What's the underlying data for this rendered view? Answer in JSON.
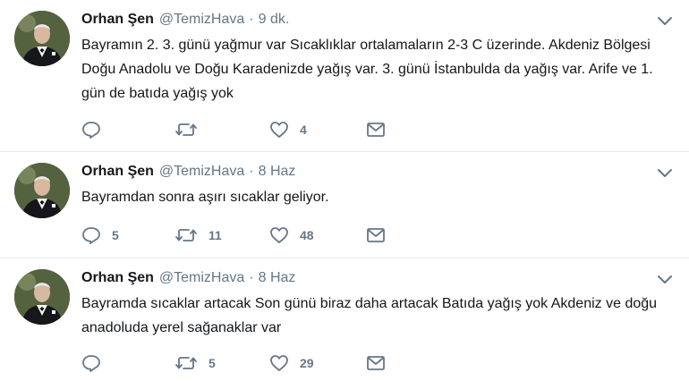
{
  "colors": {
    "text": "#14171a",
    "secondary": "#657786",
    "divider": "#e6ecf0",
    "background": "#ffffff"
  },
  "icons": {
    "caret": "chevron-down-icon",
    "reply": "reply-icon",
    "retweet": "retweet-icon",
    "like": "heart-icon",
    "message": "envelope-icon"
  },
  "tweets": [
    {
      "name": "Orhan Şen",
      "handle": "@TemizHava",
      "separator": "·",
      "time": "9 dk.",
      "text": "Bayramın 2. 3. günü yağmur var Sıcaklıklar ortalamaların 2-3 C üzerinde. Akdeniz Bölgesi Doğu Anadolu ve Doğu Karadenizde yağış var. 3. günü İstanbulda da yağış var. Arife ve 1. gün de batıda yağış yok",
      "replies": "",
      "retweets": "",
      "likes": "4"
    },
    {
      "name": "Orhan Şen",
      "handle": "@TemizHava",
      "separator": "·",
      "time": "8 Haz",
      "text": "Bayramdan sonra aşırı sıcaklar geliyor.",
      "replies": "5",
      "retweets": "11",
      "likes": "48"
    },
    {
      "name": "Orhan Şen",
      "handle": "@TemizHava",
      "separator": "·",
      "time": "8 Haz",
      "text": "Bayramda sıcaklar artacak Son günü biraz daha artacak Batıda yağış yok Akdeniz ve doğu anadoluda yerel sağanaklar var",
      "replies": "",
      "retweets": "5",
      "likes": "29"
    }
  ]
}
